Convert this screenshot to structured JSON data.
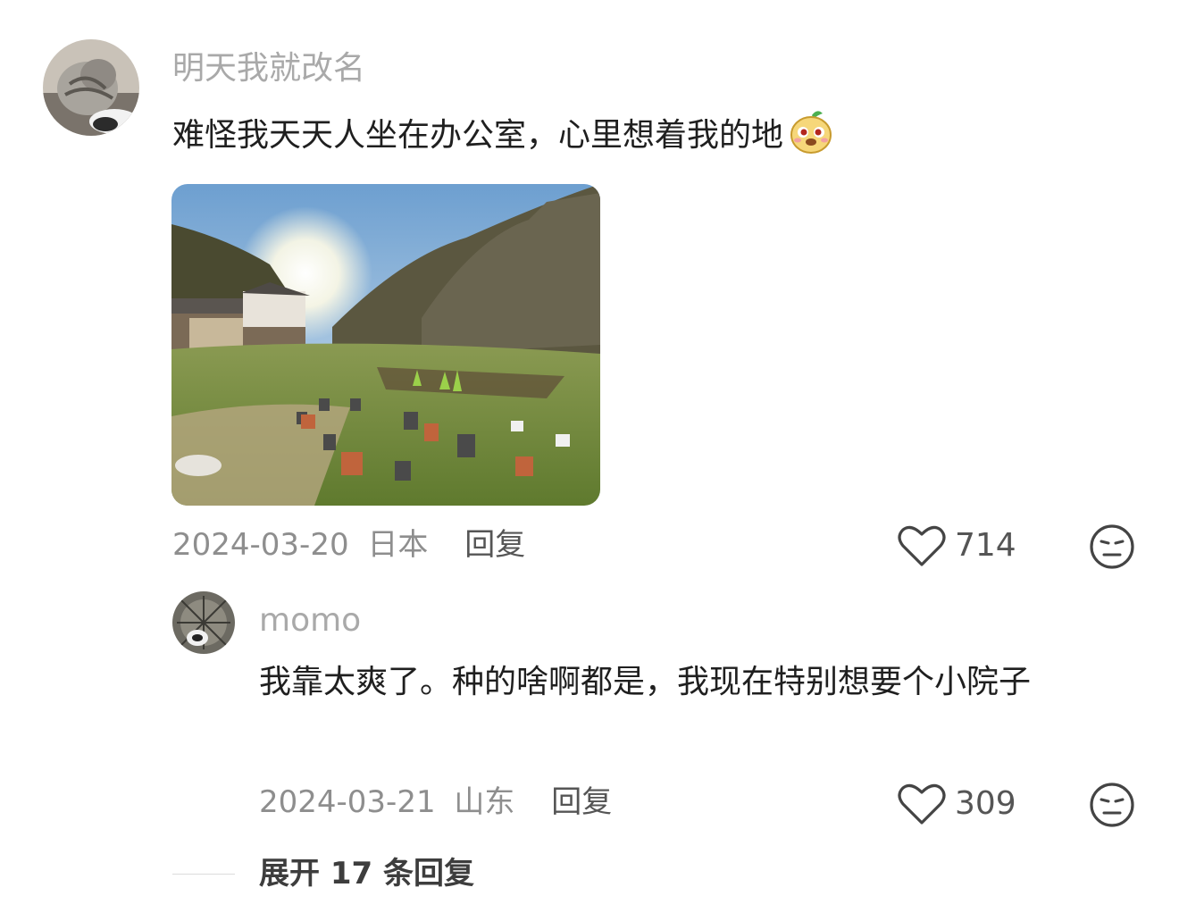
{
  "comment": {
    "username": "明天我就改名",
    "text": "难怪我天天人坐在办公室，心里想着我的地",
    "emoji_icon": "smug-mascot-emoji-icon",
    "date": "2024-03-20",
    "location": "日本",
    "reply_label": "回复",
    "likes": "714",
    "like_icon": "heart-icon",
    "dislike_icon": "unamused-face-icon"
  },
  "reply": {
    "username": "momo",
    "text": "我靠太爽了。种的啥啊都是，我现在特别想要个小院子",
    "date": "2024-03-21",
    "location": "山东",
    "reply_label": "回复",
    "likes": "309",
    "like_icon": "heart-icon",
    "dislike_icon": "unamused-face-icon"
  },
  "expand": {
    "label": "展开 17 条回复"
  },
  "colors": {
    "username": "#a9a9a9",
    "meta": "#8e8e8e",
    "text": "#1f1f1f"
  }
}
